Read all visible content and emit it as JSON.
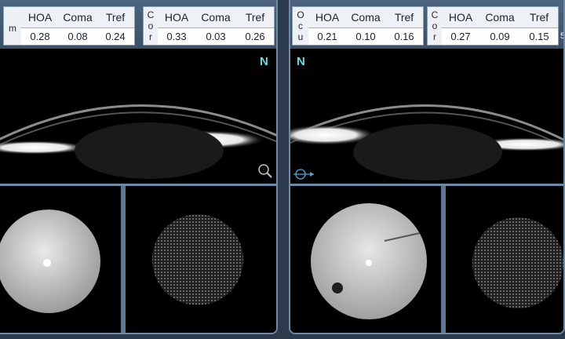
{
  "left": {
    "ocu": {
      "letters": [
        "",
        "",
        ""
      ],
      "metrics": [
        {
          "label": "HOA",
          "value": "0.28"
        },
        {
          "label": "Coma",
          "value": "0.08"
        },
        {
          "label": "Tref",
          "value": "0.24"
        }
      ]
    },
    "cor": {
      "letters": [
        "C",
        "o",
        "r"
      ],
      "metrics": [
        {
          "label": "HOA",
          "value": "0.33"
        },
        {
          "label": "Coma",
          "value": "0.03"
        },
        {
          "label": "Tref",
          "value": "0.26"
        }
      ]
    },
    "cut_label": "m",
    "orientation": "N"
  },
  "right": {
    "ocu": {
      "letters": [
        "O",
        "c",
        "u"
      ],
      "metrics": [
        {
          "label": "HOA",
          "value": "0.21"
        },
        {
          "label": "Coma",
          "value": "0.10"
        },
        {
          "label": "Tref",
          "value": "0.16"
        }
      ]
    },
    "cor": {
      "letters": [
        "C",
        "o",
        "r"
      ],
      "metrics": [
        {
          "label": "HOA",
          "value": "0.27"
        },
        {
          "label": "Coma",
          "value": "0.09"
        },
        {
          "label": "Tref",
          "value": "0.15"
        }
      ]
    },
    "cut_label": "5",
    "orientation": "N"
  },
  "icons": {
    "zoom": "magnifier-icon",
    "target": "crosshair-arrow-icon"
  },
  "colors": {
    "frame": "#6f8aa6",
    "accent": "#6fd8e6",
    "background": "#000000"
  }
}
